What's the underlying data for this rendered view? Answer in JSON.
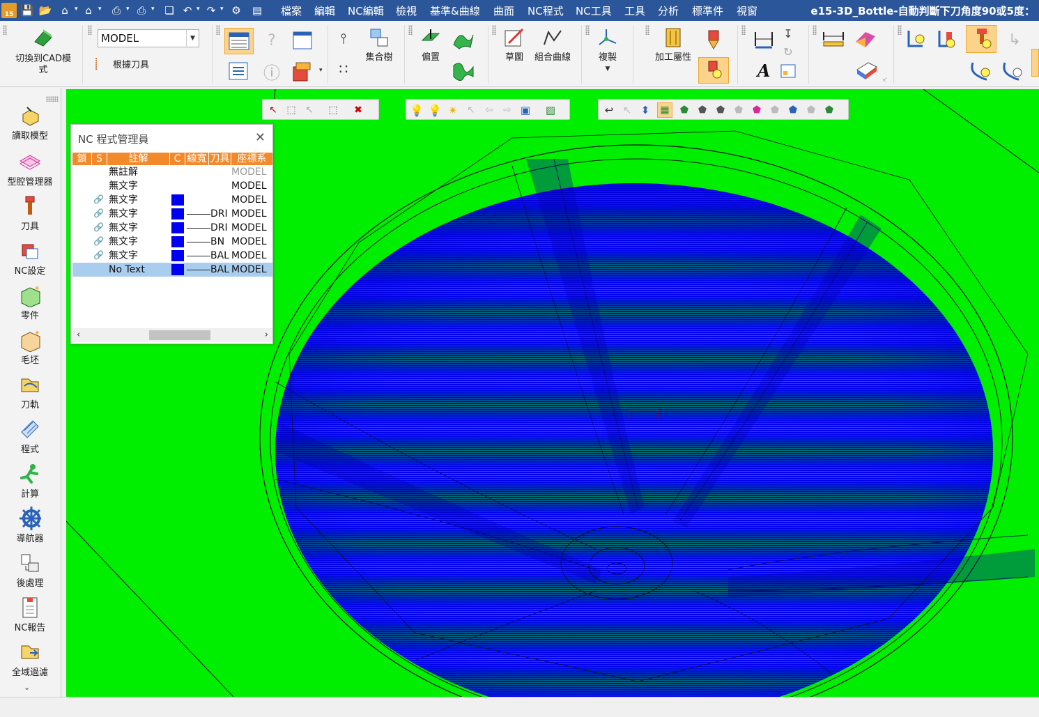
{
  "app": {
    "logo_text": "15",
    "document_title": "e15-3D_Bottle-自動判斷下刀角度90或5度："
  },
  "menu": {
    "items": [
      "檔案",
      "編輯",
      "NC編輯",
      "檢視",
      "基準&曲線",
      "曲面",
      "NC程式",
      "NC工具",
      "工具",
      "分析",
      "標準件",
      "視窗"
    ]
  },
  "ribbon": {
    "switch_cad_label_1": "切換到CAD模",
    "switch_cad_label_2": "式",
    "model_combo_value": "MODEL",
    "by_tool_label": "根據刀具",
    "collection_tree_label": "集合樹",
    "offset_label": "偏置",
    "sketch_label": "草圖",
    "composite_curve_label": "組合曲線",
    "copy_label": "複製",
    "machining_attr_label": "加工屬性"
  },
  "sidebar": {
    "items": [
      {
        "label": "讀取模型",
        "icon": "read-model-icon"
      },
      {
        "label": "型腔管理器",
        "icon": "cavity-manager-icon"
      },
      {
        "label": "刀具",
        "icon": "tool-icon"
      },
      {
        "label": "NC設定",
        "icon": "nc-setup-icon"
      },
      {
        "label": "零件",
        "icon": "part-icon"
      },
      {
        "label": "毛坯",
        "icon": "stock-icon"
      },
      {
        "label": "刀軌",
        "icon": "toolpath-icon"
      },
      {
        "label": "程式",
        "icon": "program-icon"
      },
      {
        "label": "計算",
        "icon": "compute-icon"
      },
      {
        "label": "導航器",
        "icon": "navigator-icon"
      },
      {
        "label": "後處理",
        "icon": "post-process-icon"
      },
      {
        "label": "NC報告",
        "icon": "nc-report-icon"
      },
      {
        "label": "全域過濾",
        "icon": "global-filter-icon"
      }
    ]
  },
  "nc_manager": {
    "title": "NC 程式管理員",
    "headers": [
      "鎖",
      "S",
      "註解",
      "C",
      "線寬",
      "刀具",
      "座標系"
    ],
    "rows": [
      {
        "note": "無註解",
        "has_link": false,
        "has_color": false,
        "tool": "",
        "coord": "MODEL",
        "muted": true,
        "selected": false
      },
      {
        "note": "無文字",
        "has_link": false,
        "has_color": false,
        "tool": "",
        "coord": "MODEL",
        "muted": false,
        "selected": false
      },
      {
        "note": "無文字",
        "has_link": true,
        "has_color": true,
        "tool": "",
        "coord": "MODEL",
        "muted": false,
        "selected": false
      },
      {
        "note": "無文字",
        "has_link": true,
        "has_color": true,
        "tool": "DRI",
        "coord": "MODEL",
        "muted": false,
        "selected": false
      },
      {
        "note": "無文字",
        "has_link": true,
        "has_color": true,
        "tool": "DRI",
        "coord": "MODEL",
        "muted": false,
        "selected": false
      },
      {
        "note": "無文字",
        "has_link": true,
        "has_color": true,
        "tool": "BN",
        "coord": "MODEL",
        "muted": false,
        "selected": false
      },
      {
        "note": "無文字",
        "has_link": true,
        "has_color": true,
        "tool": "BAL",
        "coord": "MODEL",
        "muted": false,
        "selected": false
      },
      {
        "note": "No Text",
        "has_link": false,
        "has_color": true,
        "tool": "BAL",
        "coord": "MODEL",
        "muted": false,
        "selected": true
      }
    ]
  },
  "colors": {
    "menubar": "#2b579a",
    "viewport_bg": "#00ee00",
    "toolpath": "#0000ee",
    "nc_header": "#f28a2c",
    "selection": "#a9cdee",
    "highlight": "#fbd38a"
  }
}
